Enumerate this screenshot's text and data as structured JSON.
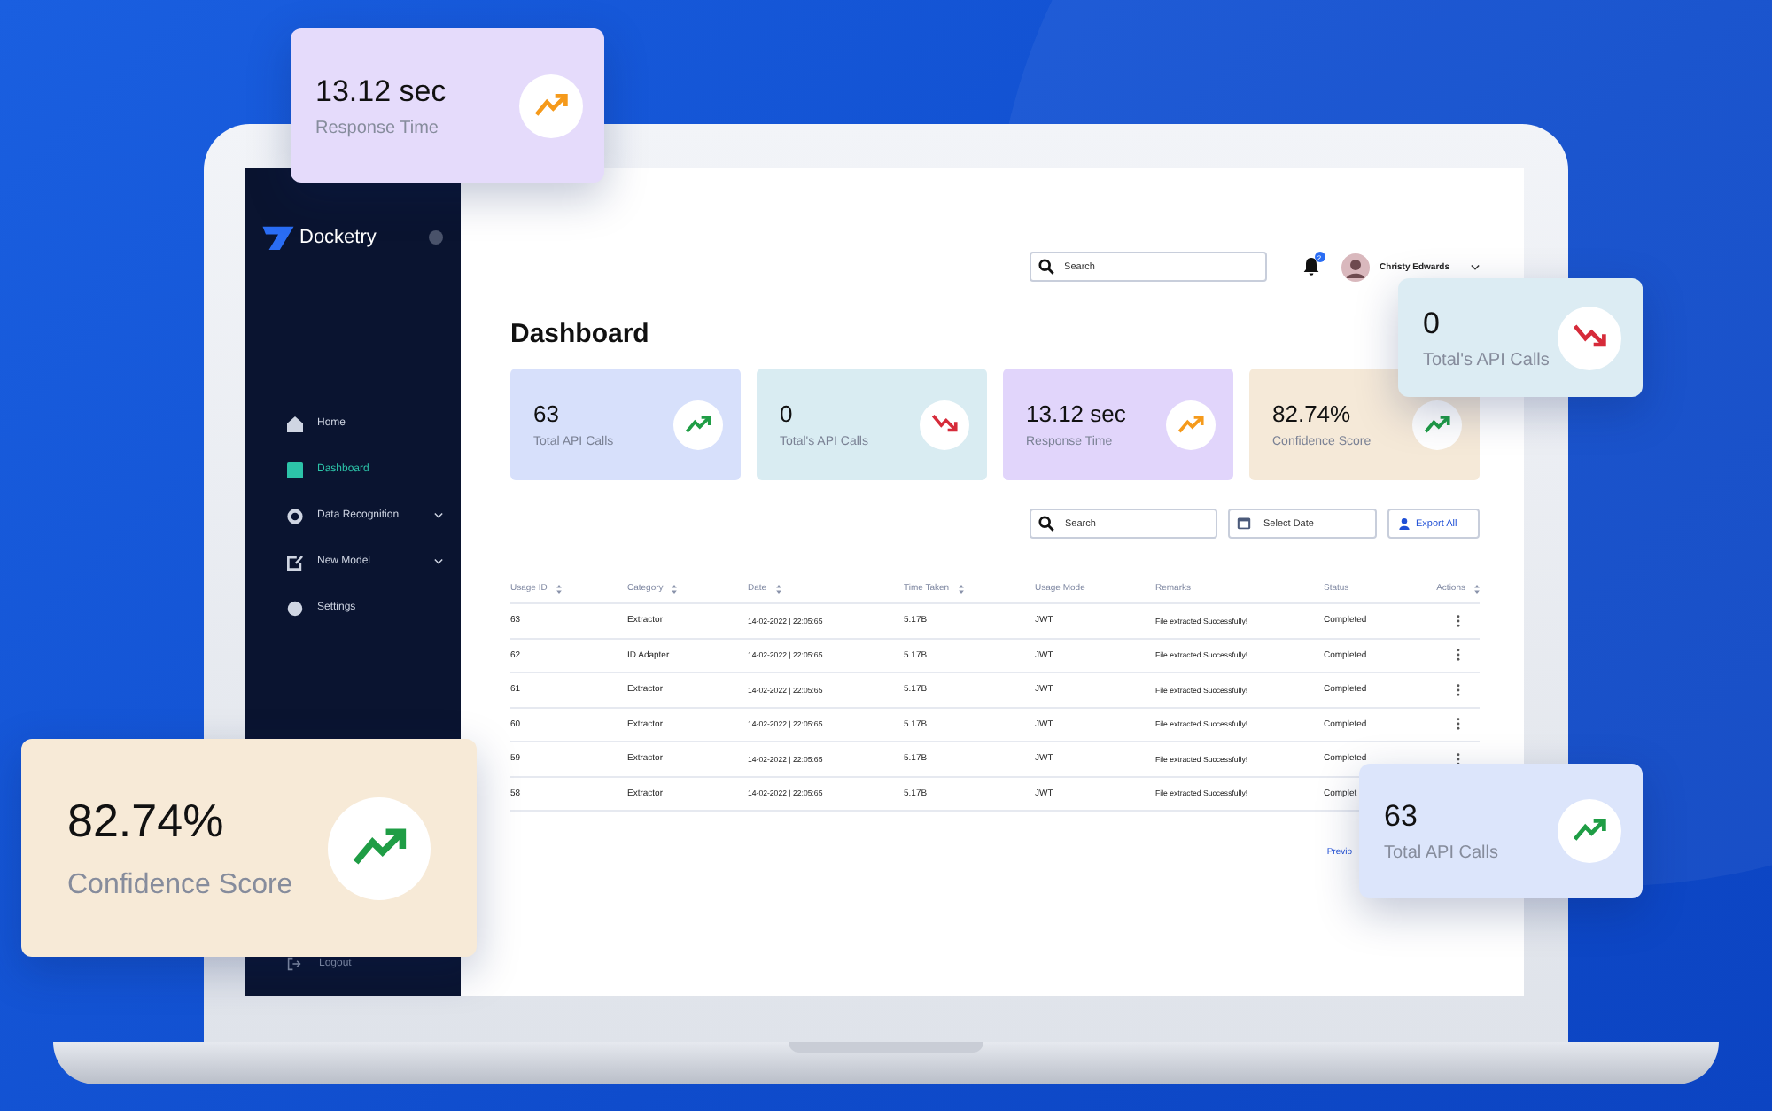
{
  "sidebar": {
    "brand": "Docketry",
    "items": [
      {
        "label": "Home",
        "selected": false,
        "has_submenu": false
      },
      {
        "label": "Dashboard",
        "selected": true,
        "has_submenu": false
      },
      {
        "label": "Data Recognition",
        "selected": false,
        "has_submenu": true
      },
      {
        "label": "New Model",
        "selected": false,
        "has_submenu": true
      },
      {
        "label": "Settings",
        "selected": false,
        "has_submenu": false
      }
    ],
    "logout": "Logout"
  },
  "header": {
    "search": {
      "placeholder": "Search"
    },
    "notifications": "2",
    "user": {
      "name": "Christy Edwards"
    }
  },
  "title": "Dashboard",
  "stat_cards": [
    {
      "value": "63",
      "label": "Total API Calls",
      "kind": "up",
      "color": "#1f9d45"
    },
    {
      "value": "0",
      "label": "Total's API Calls",
      "kind": "down",
      "color": "#d62b3a"
    },
    {
      "value": "13.12 sec",
      "label": "Response Time",
      "kind": "up",
      "color": "#f59a1b"
    },
    {
      "value": "82.74%",
      "label": "Confidence Score",
      "kind": "up",
      "color": "#1f9d45"
    }
  ],
  "toolbar": {
    "search": {
      "placeholder": "Search"
    },
    "date": {
      "placeholder": "Select Date"
    },
    "export": "Export All"
  },
  "table": {
    "columns": [
      {
        "label": "Usage ID",
        "sortable": true
      },
      {
        "label": "Category",
        "sortable": true
      },
      {
        "label": "Date",
        "sortable": true
      },
      {
        "label": "Time Taken",
        "sortable": true
      },
      {
        "label": "Usage Mode",
        "sortable": false
      },
      {
        "label": "Remarks",
        "sortable": false
      },
      {
        "label": "Status",
        "sortable": false
      },
      {
        "label": "Actions",
        "sortable": true
      }
    ],
    "rows": [
      {
        "cells": [
          "63",
          "Extractor",
          "14-02-2022 | 22:05:65",
          "5.17B",
          "JWT",
          "File extracted Successfully!",
          "Completed"
        ],
        "menu": true
      },
      {
        "cells": [
          "62",
          "ID Adapter",
          "14-02-2022 | 22:05:65",
          "5.17B",
          "JWT",
          "File extracted Successfully!",
          "Completed"
        ],
        "menu": true
      },
      {
        "cells": [
          "61",
          "Extractor",
          "14-02-2022 | 22:05:65",
          "5.17B",
          "JWT",
          "File extracted Successfully!",
          "Completed"
        ],
        "menu": true
      },
      {
        "cells": [
          "60",
          "Extractor",
          "14-02-2022 | 22:05:65",
          "5.17B",
          "JWT",
          "File extracted Successfully!",
          "Completed"
        ],
        "menu": true
      },
      {
        "cells": [
          "59",
          "Extractor",
          "14-02-2022 | 22:05:65",
          "5.17B",
          "JWT",
          "File extracted Successfully!",
          "Completed"
        ],
        "menu": true
      },
      {
        "cells": [
          "58",
          "Extractor",
          "14-02-2022 | 22:05:65",
          "5.17B",
          "JWT",
          "File extracted Successfully!",
          "Complet"
        ],
        "menu": false
      }
    ],
    "pagination": "Previo"
  },
  "floating_cards": [
    {
      "value": "13.12 sec",
      "label": "Response Time",
      "kind": "up",
      "color": "#f59a1b"
    },
    {
      "value": "0",
      "label": "Total's API Calls",
      "kind": "down",
      "color": "#d62b3a"
    },
    {
      "value": "82.74%",
      "label": "Confidence Score",
      "kind": "up",
      "color": "#1f9d45"
    },
    {
      "value": "63",
      "label": "Total API Calls",
      "kind": "up",
      "color": "#1f9d45"
    }
  ]
}
